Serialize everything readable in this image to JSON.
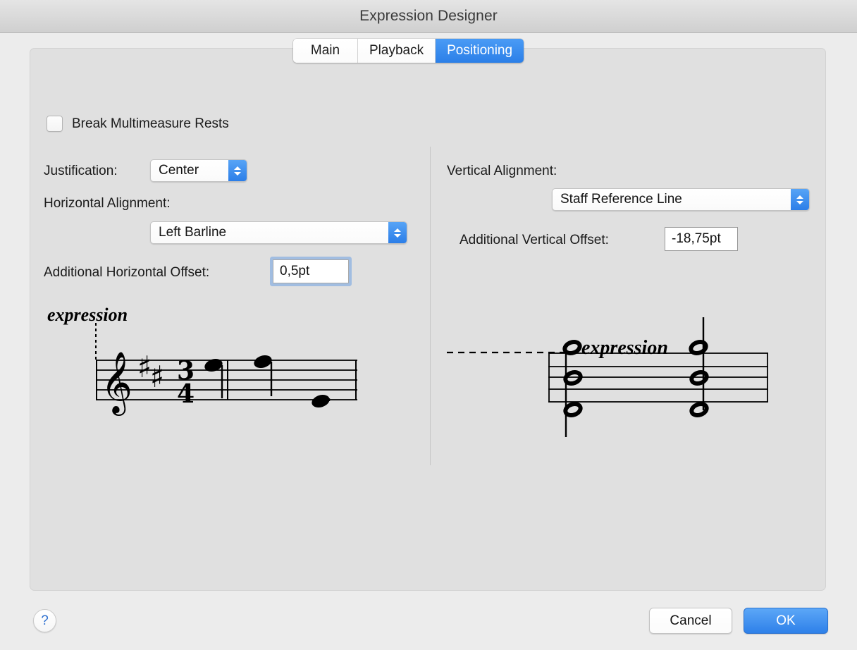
{
  "window": {
    "title": "Expression Designer"
  },
  "tabs": [
    {
      "label": "Main",
      "selected": false
    },
    {
      "label": "Playback",
      "selected": false
    },
    {
      "label": "Positioning",
      "selected": true
    }
  ],
  "options": {
    "break_multimeasure_rests": {
      "label": "Break Multimeasure Rests",
      "checked": false
    }
  },
  "horizontal": {
    "justification_label": "Justification:",
    "justification_value": "Center",
    "horizontal_alignment_label": "Horizontal Alignment:",
    "horizontal_alignment_value": "Left Barline",
    "additional_horizontal_offset_label": "Additional Horizontal Offset:",
    "additional_horizontal_offset_value": "0,5pt"
  },
  "vertical": {
    "vertical_alignment_label": "Vertical Alignment:",
    "vertical_alignment_value": "Staff Reference Line",
    "additional_vertical_offset_label": "Additional Vertical Offset:",
    "additional_vertical_offset_value": "-18,75pt"
  },
  "previews": {
    "horizontal_preview": {
      "expression_text": "expression",
      "key_signature": "2 sharps",
      "time_signature": "3/4",
      "clef": "treble"
    },
    "vertical_preview": {
      "expression_text": "expression",
      "clef": "none"
    }
  },
  "footer": {
    "help_label": "?",
    "cancel_label": "Cancel",
    "ok_label": "OK"
  },
  "colors": {
    "accent": "#2e80e9",
    "selected_tab": "#3a8bee",
    "window_bg": "#ececec",
    "panel_bg": "#e0e0e0",
    "focus_ring": "#6ea0e1"
  }
}
